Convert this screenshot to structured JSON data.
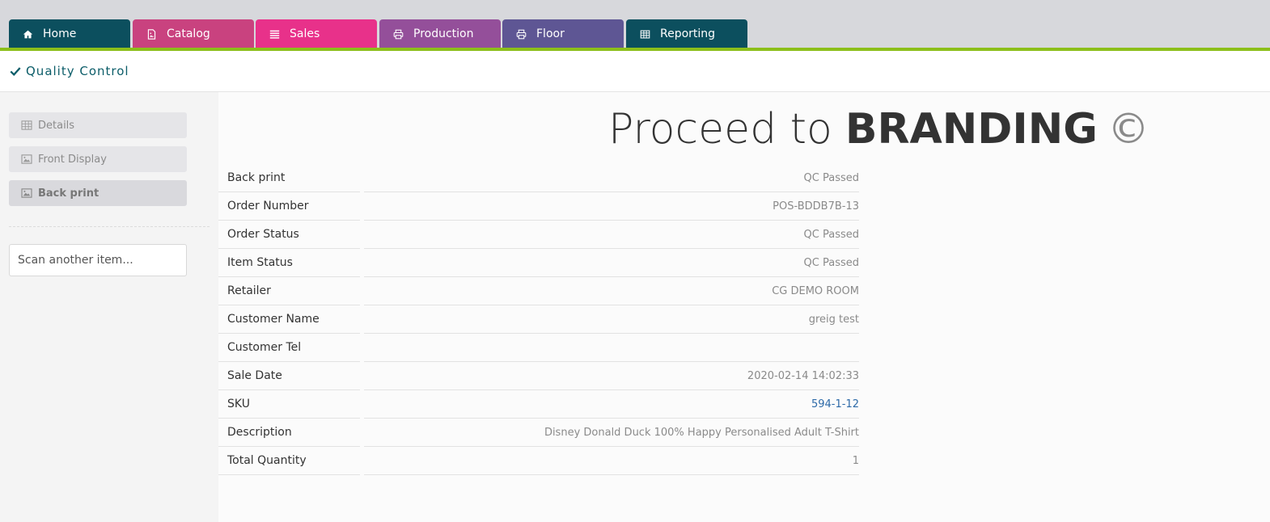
{
  "nav": {
    "tabs": [
      {
        "label": "Home",
        "icon": "home-icon",
        "color": "#0c4f5e"
      },
      {
        "label": "Catalog",
        "icon": "file-image-icon",
        "color": "#c9427f"
      },
      {
        "label": "Sales",
        "icon": "list-icon",
        "color": "#e8318a"
      },
      {
        "label": "Production",
        "icon": "printer-icon",
        "color": "#944f9a"
      },
      {
        "label": "Floor",
        "icon": "printer-icon",
        "color": "#5e5694"
      },
      {
        "label": "Reporting",
        "icon": "table-icon",
        "color": "#0c4f5e"
      }
    ],
    "accent": "#8cbf1b"
  },
  "page": {
    "title": "Quality Control"
  },
  "sidebar": {
    "buttons": [
      {
        "label": "Details",
        "icon": "table-icon"
      },
      {
        "label": "Front Display",
        "icon": "image-icon"
      },
      {
        "label": "Back print",
        "icon": "image-icon"
      }
    ],
    "scan_placeholder": "Scan another item..."
  },
  "main": {
    "headline_prefix": "Proceed to",
    "headline_destination": "BRANDING",
    "headline_symbol": "©",
    "details": [
      {
        "label": "Back print",
        "value": "QC Passed"
      },
      {
        "label": "Order Number",
        "value": "POS-BDDB7B-13"
      },
      {
        "label": "Order Status",
        "value": "QC Passed"
      },
      {
        "label": "Item Status",
        "value": "QC Passed"
      },
      {
        "label": "Retailer",
        "value": "CG DEMO ROOM"
      },
      {
        "label": "Customer Name",
        "value": "greig test"
      },
      {
        "label": "Customer Tel",
        "value": ""
      },
      {
        "label": "Sale Date",
        "value": "2020-02-14 14:02:33"
      },
      {
        "label": "SKU",
        "value": "594-1-12"
      },
      {
        "label": "Description",
        "value": "Disney Donald Duck 100% Happy Personalised Adult T-Shirt"
      },
      {
        "label": "Total Quantity",
        "value": "1"
      }
    ]
  }
}
